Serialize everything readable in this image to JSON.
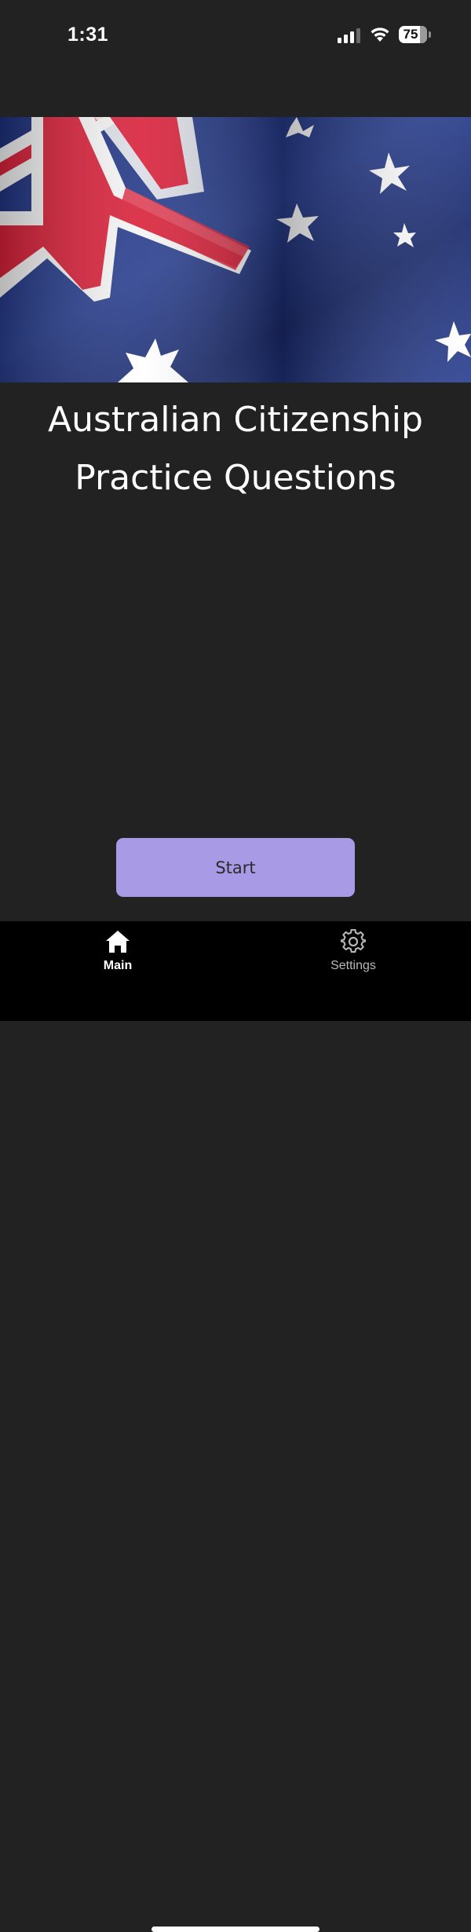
{
  "status_bar": {
    "time": "1:31",
    "battery_percent": "75",
    "battery_level": 0.75,
    "signal_bars_active": 3,
    "signal_bars_total": 4,
    "icons": [
      "signal-icon",
      "wifi-icon",
      "battery-icon"
    ]
  },
  "hero": {
    "image": "australian-flag-photo",
    "colors": {
      "blue": "#1a2a6c",
      "red": "#d8213a",
      "white": "#ffffff"
    }
  },
  "main": {
    "title_line1": "Australian Citizenship",
    "title_line2": "Practice Questions"
  },
  "actions": {
    "start_label": "Start",
    "start_color": "#a99ae6"
  },
  "tab_bar": {
    "tabs": [
      {
        "label": "Main",
        "icon": "home-icon",
        "active": true
      },
      {
        "label": "Settings",
        "icon": "gear-icon",
        "active": false
      }
    ]
  },
  "theme": {
    "background": "#222222",
    "tab_bar_background": "#000000"
  }
}
